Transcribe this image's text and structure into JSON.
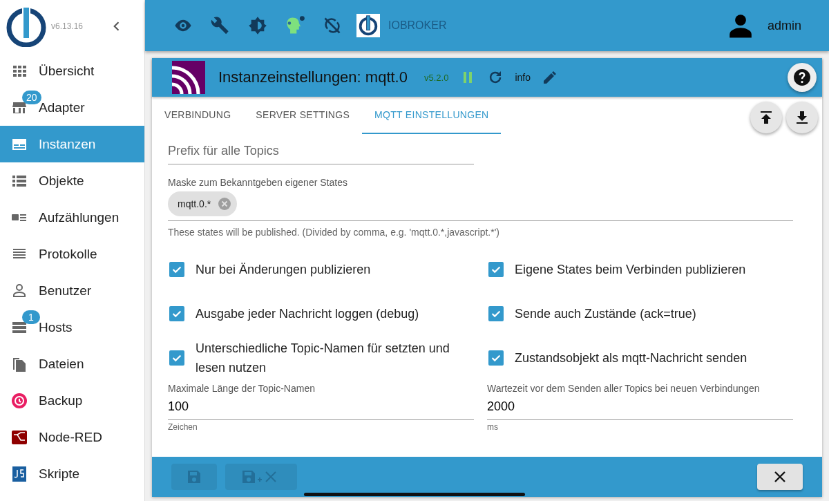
{
  "sidebar": {
    "version": "v6.13.16",
    "items": [
      {
        "label": "Übersicht",
        "selected": false
      },
      {
        "label": "Adapter",
        "selected": false,
        "badge": "20"
      },
      {
        "label": "Instanzen",
        "selected": true
      },
      {
        "label": "Objekte",
        "selected": false
      },
      {
        "label": "Aufzählungen",
        "selected": false
      },
      {
        "label": "Protokolle",
        "selected": false
      },
      {
        "label": "Benutzer",
        "selected": false
      },
      {
        "label": "Hosts",
        "selected": false,
        "badge": "1"
      },
      {
        "label": "Dateien",
        "selected": false
      },
      {
        "label": "Backup",
        "selected": false
      },
      {
        "label": "Node-RED",
        "selected": false
      },
      {
        "label": "Skripte",
        "selected": false
      }
    ]
  },
  "topbar": {
    "brand": "IOBROKER",
    "user": "admin"
  },
  "instance": {
    "title": "Instanzeinstellungen: mqtt.0",
    "version": "v5.2.0",
    "info": "info"
  },
  "tabs": [
    {
      "label": "VERBINDUNG",
      "selected": false
    },
    {
      "label": "SERVER SETTINGS",
      "selected": false
    },
    {
      "label": "MQTT EINSTELLUNGEN",
      "selected": true
    }
  ],
  "form": {
    "prefix": {
      "placeholder": "Prefix für alle Topics"
    },
    "mask": {
      "label": "Maske zum Bekanntgeben eigener States",
      "chips": [
        "mqtt.0.*"
      ],
      "helper": "These states will be published. (Divided by comma, e.g. 'mqtt.0.*,javascript.*')"
    },
    "checkboxes": [
      {
        "label": "Nur bei Änderungen publizieren",
        "checked": true
      },
      {
        "label": "Eigene States beim Verbinden publizieren",
        "checked": true
      },
      {
        "label": "Ausgabe jeder Nachricht loggen (debug)",
        "checked": true
      },
      {
        "label": "Sende auch Zustände (ack=true)",
        "checked": true
      },
      {
        "label": "Unterschiedliche Topic-Namen für setzten und lesen nutzen",
        "checked": true
      },
      {
        "label": "Zustandsobjekt als mqtt-Nachricht senden",
        "checked": true
      }
    ],
    "fields": [
      {
        "label": "Maximale Länge der Topic-Namen",
        "value": "100",
        "helper": "Zeichen"
      },
      {
        "label": "Wartezeit vor dem Senden aller Topics bei neuen Verbindungen",
        "value": "2000",
        "helper": "ms"
      }
    ]
  }
}
